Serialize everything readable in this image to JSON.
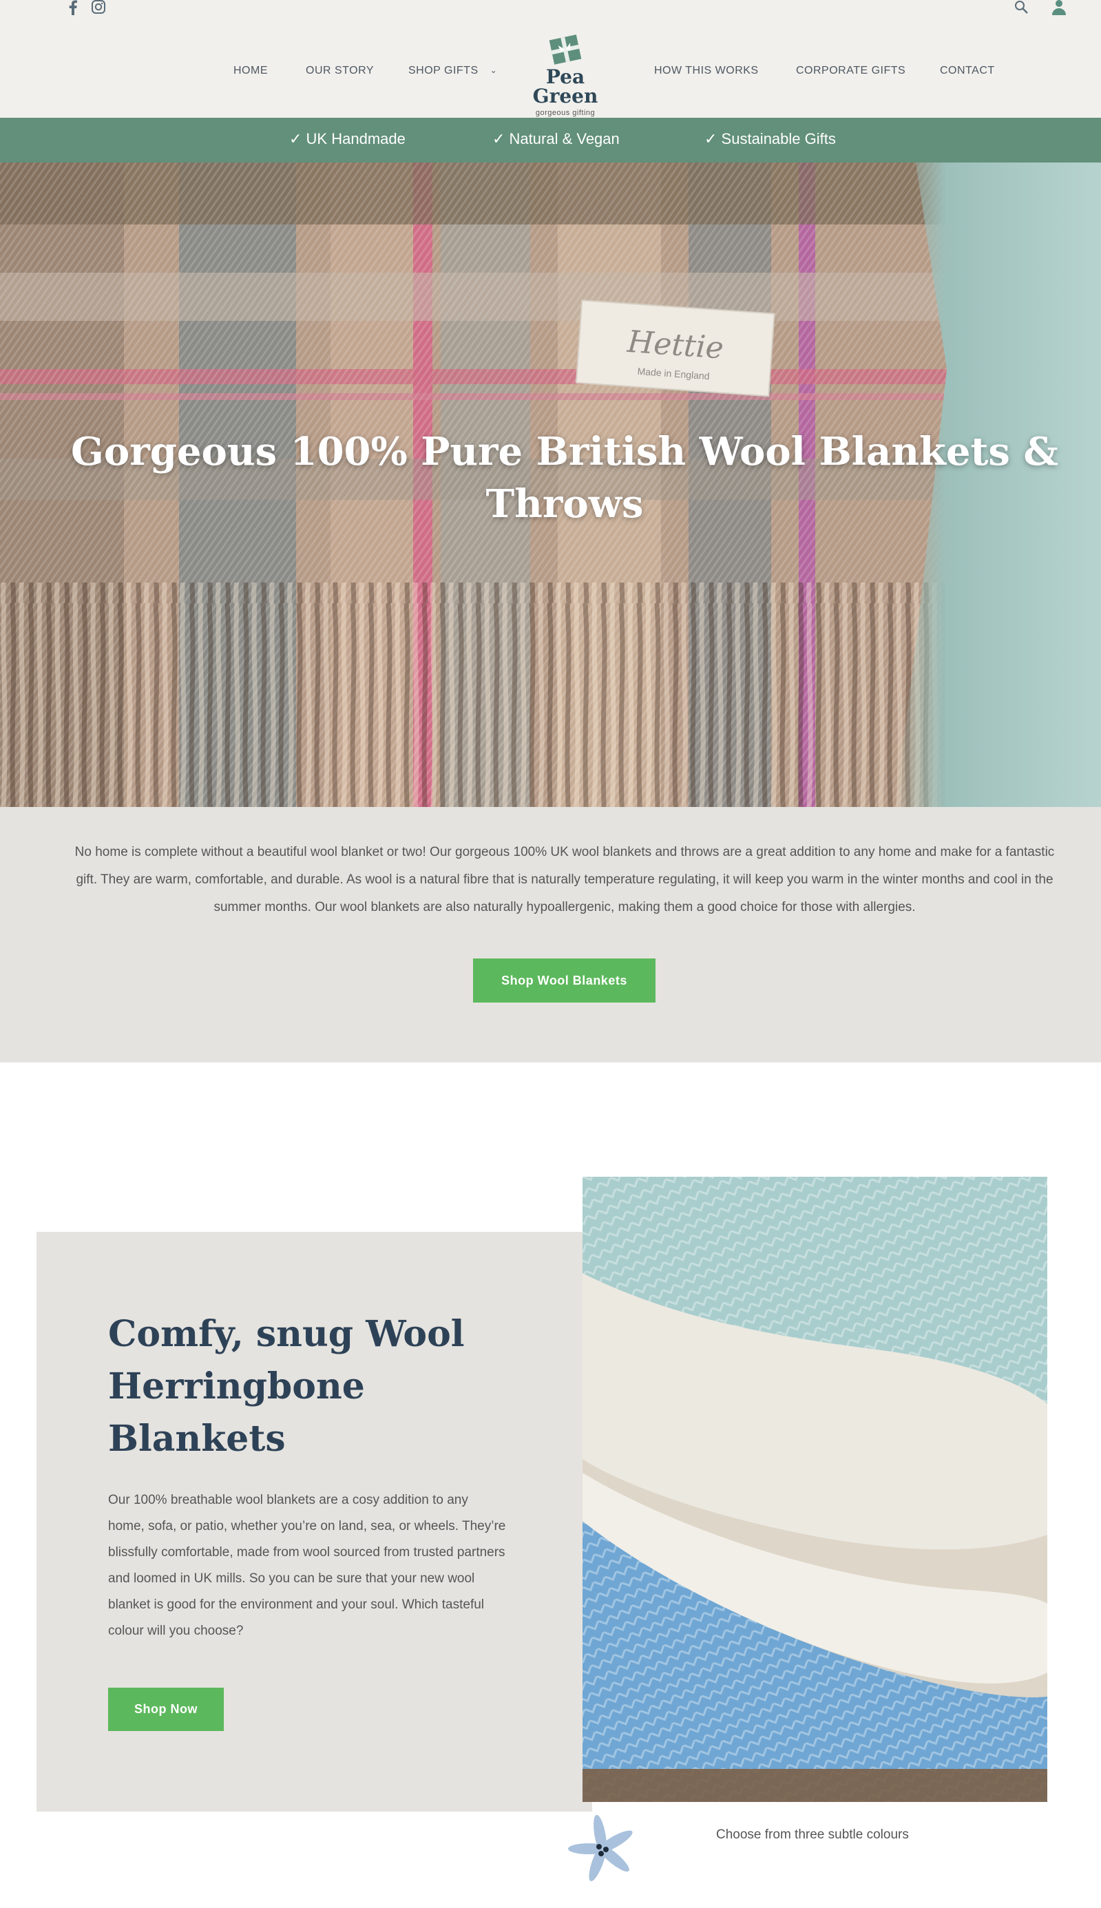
{
  "header": {
    "social": [
      "facebook-icon",
      "instagram-icon"
    ],
    "utility": [
      "search-icon",
      "account-icon"
    ],
    "nav_left": [
      "HOME",
      "OUR STORY",
      "SHOP GIFTS"
    ],
    "nav_right": [
      "HOW THIS WORKS",
      "CORPORATE GIFTS",
      "CONTACT"
    ],
    "logo": {
      "name": "Pea Green",
      "tagline": "gorgeous gifting"
    }
  },
  "usp": [
    "✓  UK Handmade",
    "✓  Natural & Vegan",
    "✓  Sustainable Gifts"
  ],
  "hero": {
    "title": "Gorgeous 100% Pure British Wool Blankets & Throws",
    "label_text": "Hettie",
    "label_sub": "Made in England"
  },
  "intro": {
    "text": "No home is complete without a beautiful wool blanket or two! Our gorgeous 100% UK wool blankets and throws are a great addition to any home and make for a fantastic gift. They are warm, comfortable, and durable. As wool is a natural fibre that is naturally temperature regulating, it will keep you warm in the winter months and cool in the summer months. Our wool blankets are also naturally hypoallergenic, making them a good choice for those with allergies.",
    "button": "Shop Wool Blankets"
  },
  "feature": {
    "title": "Comfy, snug Wool Herringbone Blankets",
    "text": "Our 100% breathable wool blankets are a cosy addition to any home, sofa, or patio, whether you’re on land, sea, or wheels. They’re blissfully comfortable, made from wool sourced from trusted partners and loomed in UK mills. So you can be sure that your new wool blanket is good for the environment and your soul. Which tasteful colour will you choose?",
    "button": "Shop Now",
    "caption": "Choose from three subtle colours"
  },
  "colors": {
    "header_bg": "#f1f0ec",
    "usp_bg": "#62907a",
    "button": "#5cb85c",
    "heading": "#2e4257",
    "panel_bg": "#e5e3df"
  }
}
